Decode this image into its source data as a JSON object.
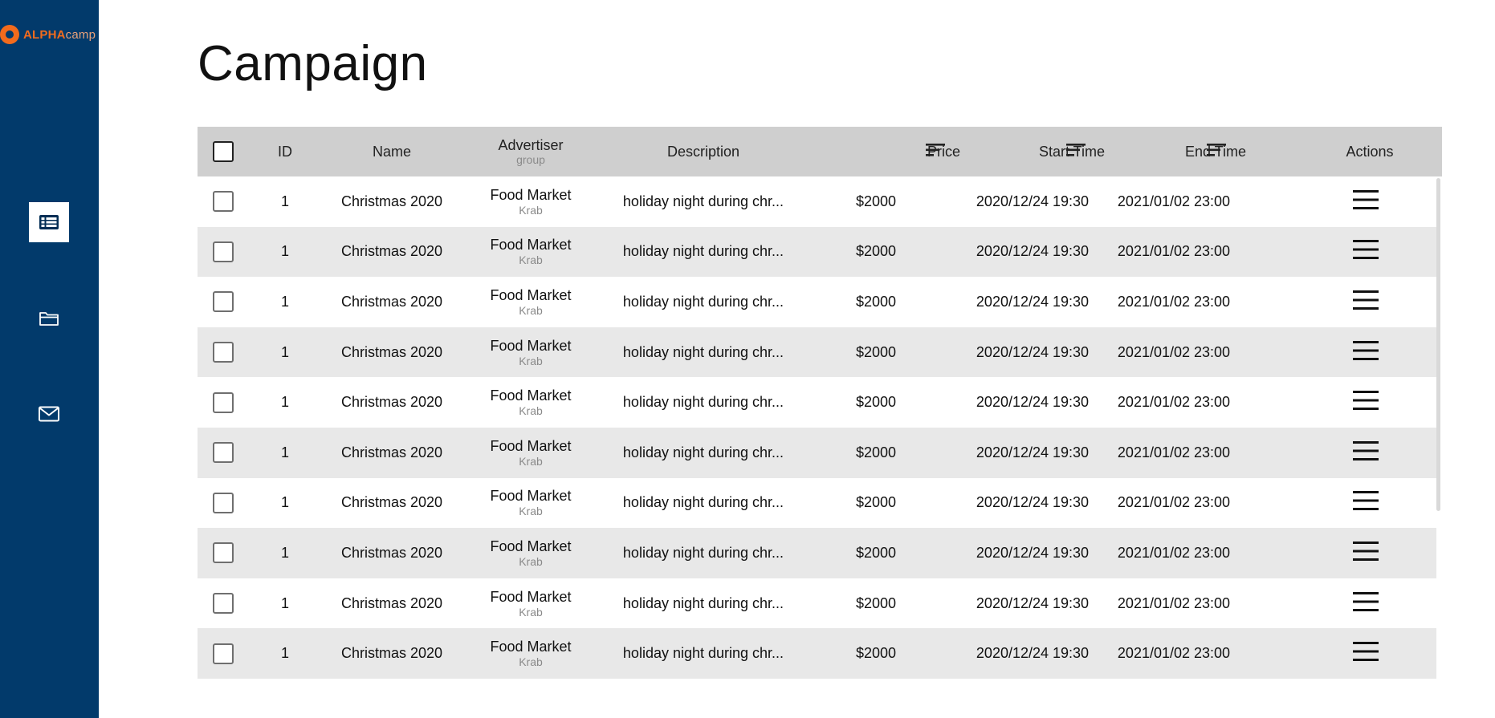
{
  "brand": {
    "logo_text_bold": "ALPHA",
    "logo_text_light": "camp"
  },
  "sidebar": {
    "items": [
      {
        "name": "table-icon",
        "active": true
      },
      {
        "name": "folder-icon",
        "active": false
      },
      {
        "name": "mail-icon",
        "active": false
      }
    ]
  },
  "page": {
    "title": "Campaign"
  },
  "table": {
    "headers": {
      "id": "ID",
      "name": "Name",
      "advertiser": "Advertiser",
      "advertiser_sub": "group",
      "description": "Description",
      "price": "Price",
      "start_time": "Start Time",
      "end_time": "End Time",
      "actions": "Actions"
    },
    "rows": [
      {
        "id": "1",
        "name": "Christmas 2020",
        "advertiser": "Food Market",
        "group": "Krab",
        "description": "holiday night during chr...",
        "price": "$2000",
        "start": "2020/12/24 19:30",
        "end": "2021/01/02 23:00"
      },
      {
        "id": "1",
        "name": "Christmas 2020",
        "advertiser": "Food Market",
        "group": "Krab",
        "description": "holiday night during chr...",
        "price": "$2000",
        "start": "2020/12/24 19:30",
        "end": "2021/01/02 23:00"
      },
      {
        "id": "1",
        "name": "Christmas 2020",
        "advertiser": "Food Market",
        "group": "Krab",
        "description": "holiday night during chr...",
        "price": "$2000",
        "start": "2020/12/24 19:30",
        "end": "2021/01/02 23:00"
      },
      {
        "id": "1",
        "name": "Christmas 2020",
        "advertiser": "Food Market",
        "group": "Krab",
        "description": "holiday night during chr...",
        "price": "$2000",
        "start": "2020/12/24 19:30",
        "end": "2021/01/02 23:00"
      },
      {
        "id": "1",
        "name": "Christmas 2020",
        "advertiser": "Food Market",
        "group": "Krab",
        "description": "holiday night during chr...",
        "price": "$2000",
        "start": "2020/12/24 19:30",
        "end": "2021/01/02 23:00"
      },
      {
        "id": "1",
        "name": "Christmas 2020",
        "advertiser": "Food Market",
        "group": "Krab",
        "description": "holiday night during chr...",
        "price": "$2000",
        "start": "2020/12/24 19:30",
        "end": "2021/01/02 23:00"
      },
      {
        "id": "1",
        "name": "Christmas 2020",
        "advertiser": "Food Market",
        "group": "Krab",
        "description": "holiday night during chr...",
        "price": "$2000",
        "start": "2020/12/24 19:30",
        "end": "2021/01/02 23:00"
      },
      {
        "id": "1",
        "name": "Christmas 2020",
        "advertiser": "Food Market",
        "group": "Krab",
        "description": "holiday night during chr...",
        "price": "$2000",
        "start": "2020/12/24 19:30",
        "end": "2021/01/02 23:00"
      },
      {
        "id": "1",
        "name": "Christmas 2020",
        "advertiser": "Food Market",
        "group": "Krab",
        "description": "holiday night during chr...",
        "price": "$2000",
        "start": "2020/12/24 19:30",
        "end": "2021/01/02 23:00"
      },
      {
        "id": "1",
        "name": "Christmas 2020",
        "advertiser": "Food Market",
        "group": "Krab",
        "description": "holiday night during chr...",
        "price": "$2000",
        "start": "2020/12/24 19:30",
        "end": "2021/01/02 23:00"
      }
    ]
  },
  "colors": {
    "sidebar": "#023a6b",
    "brand_orange": "#f26b1d",
    "header_bg": "#cfcfcf",
    "row_alt": "#e8e8e8"
  }
}
